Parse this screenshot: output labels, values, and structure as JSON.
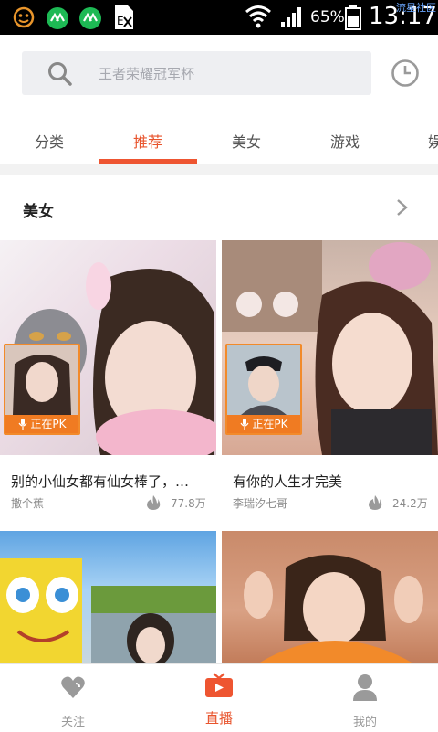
{
  "status_bar": {
    "battery_percent": "65%",
    "time": "13:17",
    "watermark": "流星社区",
    "icons": [
      "smiley-icon",
      "app-icon",
      "app-icon",
      "sim-icon",
      "wifi-icon",
      "signal-icon",
      "battery-icon"
    ]
  },
  "search": {
    "placeholder": "王者荣耀冠军杯"
  },
  "tabs": [
    {
      "label": "分类",
      "active": false
    },
    {
      "label": "推荐",
      "active": true
    },
    {
      "label": "美女",
      "active": false
    },
    {
      "label": "游戏",
      "active": false
    },
    {
      "label": "娱",
      "active": false
    }
  ],
  "section": {
    "title": "美女"
  },
  "cards": [
    {
      "title": "别的小仙女都有仙女棒了，…",
      "author": "撒个蕉",
      "heat": "77.8万",
      "badge": "正在PK"
    },
    {
      "title": "有你的人生才完美",
      "author": "李瑞汐七哥",
      "heat": "24.2万",
      "badge": "正在PK"
    },
    {
      "title": "",
      "author": "",
      "heat": "",
      "badge": ""
    },
    {
      "title": "",
      "author": "",
      "heat": "",
      "badge": ""
    }
  ],
  "bottom_nav": [
    {
      "label": "关注",
      "icon": "heart-icon",
      "active": false
    },
    {
      "label": "直播",
      "icon": "tv-icon",
      "active": true
    },
    {
      "label": "我的",
      "icon": "person-icon",
      "active": false
    }
  ],
  "colors": {
    "accent": "#ee5531",
    "pk_badge": "#f07b22",
    "status_bar": "#000000"
  }
}
